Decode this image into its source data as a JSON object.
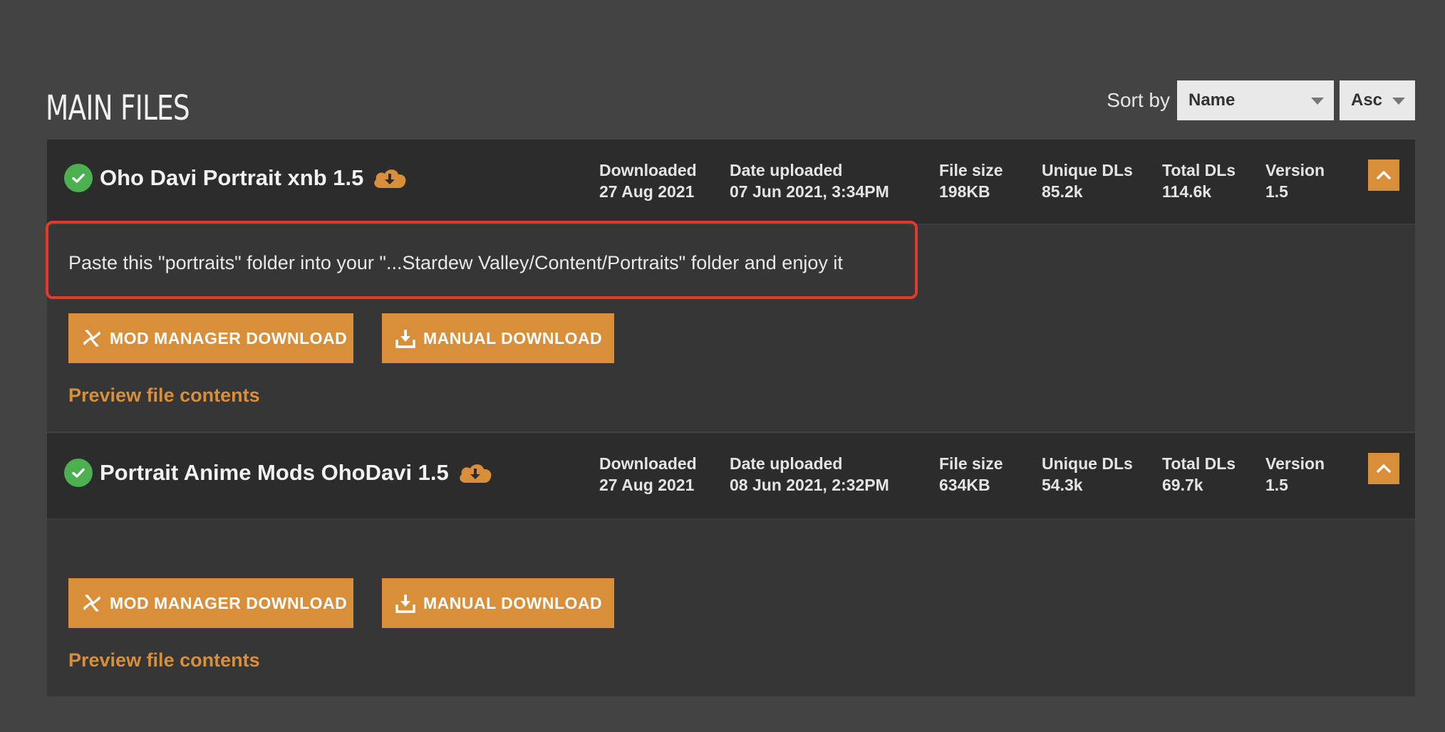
{
  "section": {
    "title": "MAIN FILES",
    "sort_label": "Sort by",
    "sort_field": "Name",
    "sort_order": "Asc"
  },
  "stat_labels": {
    "downloaded": "Downloaded",
    "date_uploaded": "Date uploaded",
    "file_size": "File size",
    "unique_dls": "Unique DLs",
    "total_dls": "Total DLs",
    "version": "Version"
  },
  "buttons": {
    "mod_manager": "MOD MANAGER DOWNLOAD",
    "manual": "MANUAL DOWNLOAD",
    "preview": "Preview file contents"
  },
  "files": [
    {
      "name": "Oho Davi Portrait xnb 1.5",
      "downloaded": "27 Aug 2021",
      "date_uploaded": "07 Jun 2021, 3:34PM",
      "file_size": "198KB",
      "unique_dls": "85.2k",
      "total_dls": "114.6k",
      "version": "1.5",
      "description": "Paste this \"portraits\" folder into your \"...Stardew Valley/Content/Portraits\" folder and enjoy it"
    },
    {
      "name": "Portrait Anime Mods OhoDavi 1.5",
      "downloaded": "27 Aug 2021",
      "date_uploaded": "08 Jun 2021, 2:32PM",
      "file_size": "634KB",
      "unique_dls": "54.3k",
      "total_dls": "69.7k",
      "version": "1.5",
      "description": ""
    }
  ],
  "colors": {
    "accent": "#d98e3a",
    "success": "#4caf50",
    "highlight": "#e2392c",
    "background": "#434343"
  },
  "icons": {
    "status": "check-circle-icon",
    "downloaded": "cloud-download-icon",
    "collapse": "chevron-up-icon",
    "mod_manager": "vortex-fan-icon",
    "manual": "download-tray-icon"
  }
}
